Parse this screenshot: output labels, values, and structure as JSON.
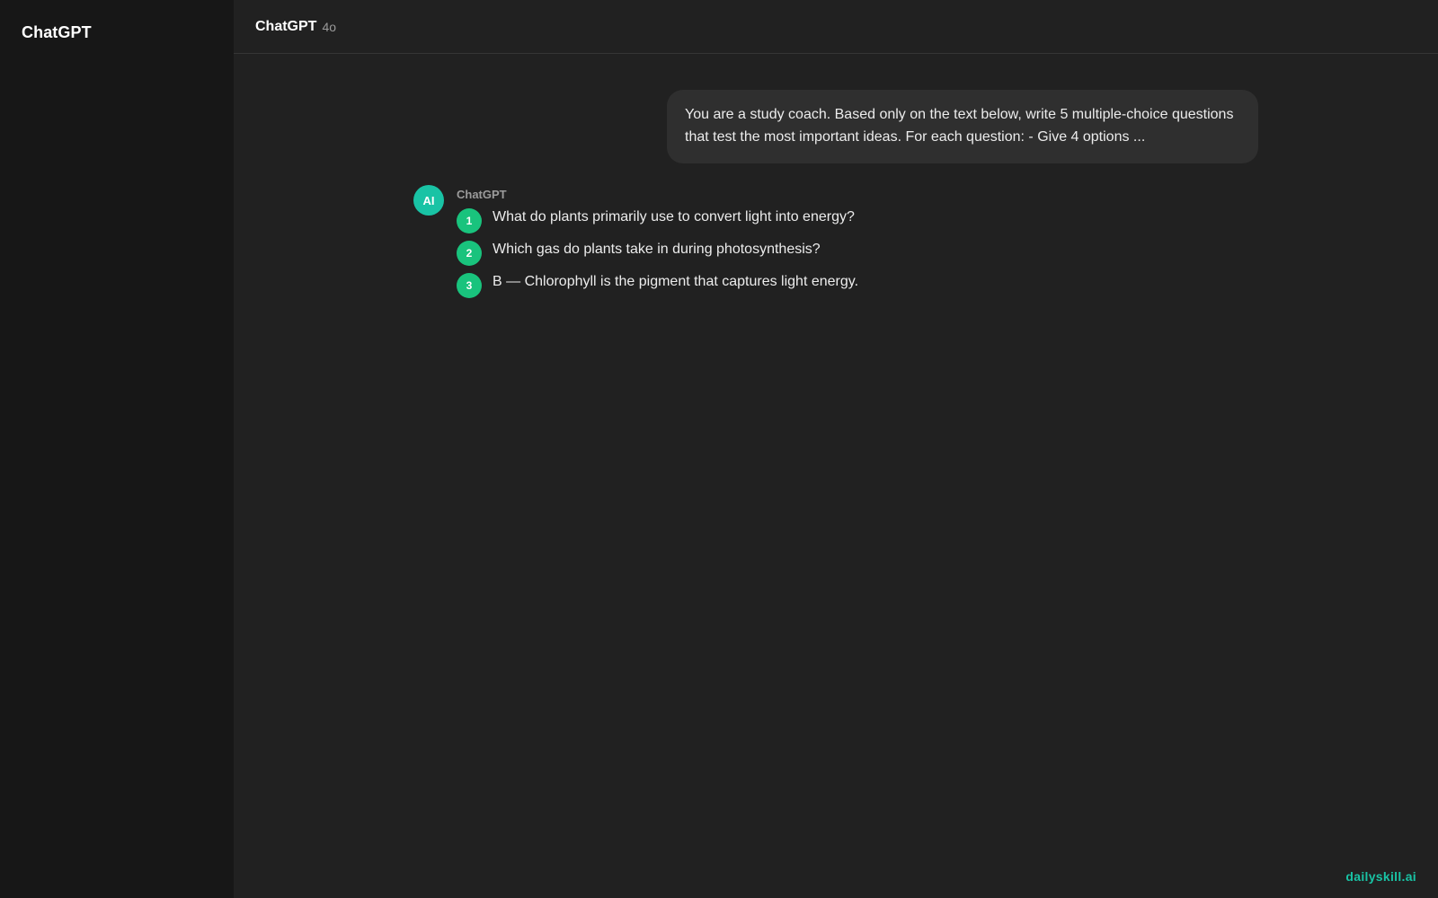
{
  "sidebar": {
    "title": "ChatGPT"
  },
  "header": {
    "title": "ChatGPT",
    "model": "4o"
  },
  "conversation": {
    "user_message": "You are a study coach. Based only on the text below, write 5 multiple-choice questions that test the most important ideas. For each question: - Give 4 options ...",
    "assistant": {
      "avatar_text": "AI",
      "name": "ChatGPT",
      "items": [
        {
          "number": "1",
          "text": "What do plants primarily use to convert light into energy?"
        },
        {
          "number": "2",
          "text": "Which gas do plants take in during photosynthesis?"
        },
        {
          "number": "3",
          "text": "B — Chlorophyll is the pigment that captures light energy."
        }
      ]
    }
  },
  "watermark": "dailyskill.ai",
  "colors": {
    "background": "#212121",
    "sidebar": "#171717",
    "user_bubble": "#2f2f2f",
    "avatar": "#19c3a5",
    "number_badge": "#19c37d",
    "watermark": "#19c3a5"
  }
}
